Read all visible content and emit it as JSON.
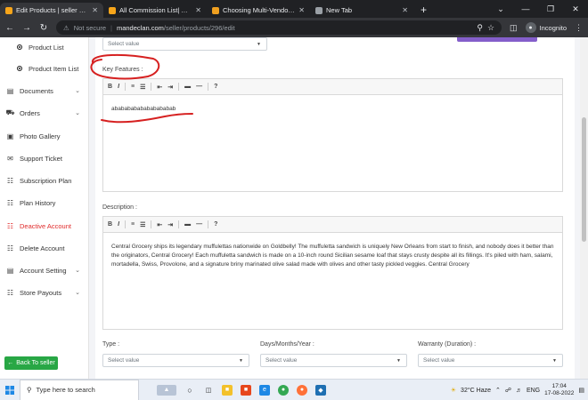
{
  "browser": {
    "tabs": [
      {
        "title": "Edit Products | seller Mande Clan",
        "favicon": "#f7a51a",
        "active": true
      },
      {
        "title": "All Commission List| Admin Mand",
        "favicon": "#f7a51a",
        "active": false
      },
      {
        "title": "Choosing Multi-Vendor eComme",
        "favicon": "#f0a020",
        "active": false
      },
      {
        "title": "New Tab",
        "favicon": "#9aa0a6",
        "active": false
      }
    ],
    "security_label": "Not secure",
    "url_host": "mandeclan.com",
    "url_path": "/seller/products/296/edit",
    "profile_label": "Incognito"
  },
  "sidebar": {
    "items": [
      {
        "label": "Product List",
        "icon": "circle-dot-icon",
        "sub": true,
        "chevron": false,
        "danger": false
      },
      {
        "label": "Product Item List",
        "icon": "circle-dot-icon",
        "sub": true,
        "chevron": false,
        "danger": false
      },
      {
        "label": "Documents",
        "icon": "document-icon",
        "sub": false,
        "chevron": true,
        "danger": false
      },
      {
        "label": "Orders",
        "icon": "cart-icon",
        "sub": false,
        "chevron": true,
        "danger": false
      },
      {
        "label": "Photo Gallery",
        "icon": "image-icon",
        "sub": false,
        "chevron": false,
        "danger": false
      },
      {
        "label": "Support Ticket",
        "icon": "ticket-icon",
        "sub": false,
        "chevron": false,
        "danger": false
      },
      {
        "label": "Subscription Plan",
        "icon": "cards-icon",
        "sub": false,
        "chevron": false,
        "danger": false
      },
      {
        "label": "Plan History",
        "icon": "history-icon",
        "sub": false,
        "chevron": false,
        "danger": false
      },
      {
        "label": "Deactive Account",
        "icon": "user-x-icon",
        "sub": false,
        "chevron": false,
        "danger": true
      },
      {
        "label": "Delete Account",
        "icon": "trash-icon",
        "sub": false,
        "chevron": false,
        "danger": false
      },
      {
        "label": "Account Setting",
        "icon": "settings-icon",
        "sub": false,
        "chevron": true,
        "danger": false
      },
      {
        "label": "Store Payouts",
        "icon": "wallet-icon",
        "sub": false,
        "chevron": true,
        "danger": false
      }
    ],
    "back_button": "Back To seller"
  },
  "form": {
    "top_select_placeholder": "Select value",
    "key_features_label": "Key Features :",
    "key_features_value": "abababababababababab",
    "description_label": "Description :",
    "description_value": "Central Grocery ships its legendary muffulettas nationwide on Goldbelly! The muffuletta sandwich is uniquely New Orleans from start to finish, and nobody does it better than the originators, Central Grocery! Each muffuletta sandwich is made on a 10-inch round Sicilian sesame loaf that stays crusty despite all its fillings. It's piled with ham, salami, mortadella, Swiss, Provolone, and a signature briny marinated olive salad made with olives and other tasty pickled veggies. Central Grocery",
    "editor_toolbar": [
      "B",
      "I",
      "≡",
      "☰",
      "⇤",
      "⇥",
      "▬",
      "—",
      "?"
    ],
    "type_label": "Type :",
    "type_value": "Select value",
    "days_label": "Days/Months/Year :",
    "days_value": "Select value",
    "warranty_label": "Warranty (Duration) :",
    "warranty_value": "Select value"
  },
  "taskbar": {
    "search_placeholder": "Type here to search",
    "weather": "32°C  Haze",
    "language": "ENG",
    "time": "17:04",
    "date": "17-08-2022"
  },
  "colors": {
    "annotation": "#d62020",
    "back_button": "#28a745",
    "danger": "#e02b2b"
  }
}
